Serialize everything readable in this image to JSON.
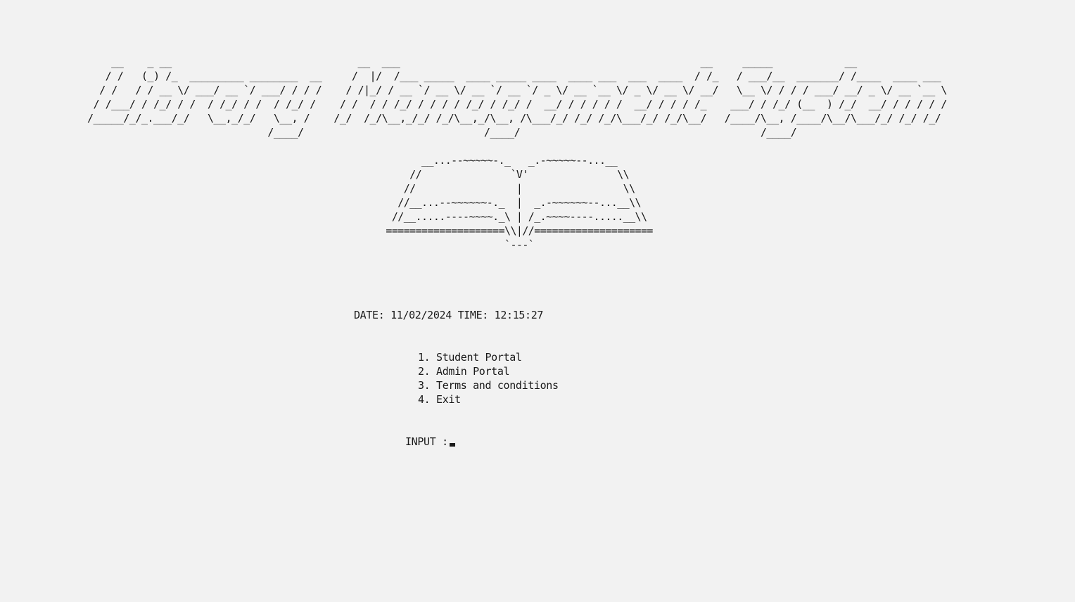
{
  "window": {
    "title_banner_lines": [
      "    __    _ __                               __  ___                                                  __     _____            __                 ",
      "   / /   (_) /_  _________ ________  __     /  |/  /___ _____  ____ _____ ____  ____ ___  ___  ____  / /_   / ___/__  _______/ /____  ____ ___ ",
      "  / /   / / __ \\/ ___/ __ `/ ___/ / / /    / /|_/ / __ `/ __ \\/ __ `/ __ `/ _ \\/ __ `__ \\/ _ \\/ __ \\/ __/   \\__ \\/ / / / ___/ __/ _ \\/ __ `__ \\",
      " / /___/ / /_/ / /  / /_/ / /  / /_/ /    / /  / / /_/ / / / / /_/ / /_/ /  __/ / / / / /  __/ / / / /_    ___/ / /_/ (__  ) /_/  __/ / / / / /",
      "/_____/_/_.___/_/   \\__,_/_/   \\__, /    /_/  /_/\\__,_/_/ /_/\\__,_/\\__, /\\___/_/ /_/ /_/\\___/_/ /_/\\__/   /____/\\__, /____/\\__/\\___/_/ /_/ /_/ ",
      "                              /____/                              /____/                                        /____/                         "
    ],
    "book_art_lines": [
      "       __...--~~~~~-._   _.-~~~~~--...__",
      "     //               `V'               \\\\",
      "    //                 |                 \\\\",
      "   //__...--~~~~~~-._  |  _.-~~~~~~--...__\\\\",
      "  //__.....----~~~~._\\ | /_.~~~~----.....__\\\\",
      " ====================\\\\|//====================",
      "                     `---`"
    ]
  },
  "status": {
    "datetime_text": "DATE: 11/02/2024 TIME: 12:15:27"
  },
  "menu": {
    "items": [
      {
        "label": "1. Student Portal"
      },
      {
        "label": "2. Admin Portal"
      },
      {
        "label": "3. Terms and conditions"
      },
      {
        "label": "4. Exit"
      }
    ]
  },
  "prompt": {
    "label": "INPUT :"
  }
}
